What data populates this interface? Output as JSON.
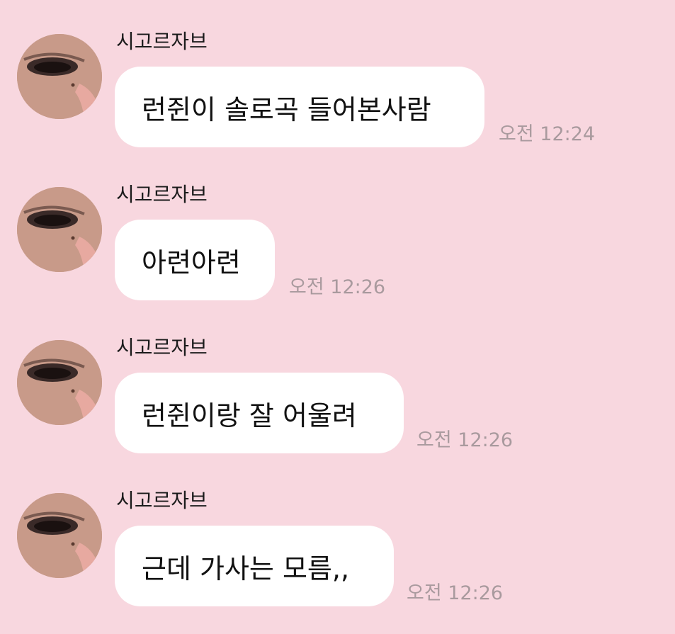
{
  "messages": [
    {
      "sender": "시고르자브",
      "text": "런쥔이 솔로곡 들어본사람",
      "time": "오전 12:24"
    },
    {
      "sender": "시고르자브",
      "text": "아련아련",
      "time": "오전 12:26"
    },
    {
      "sender": "시고르자브",
      "text": "런쥔이랑 잘 어울려",
      "time": "오전 12:26"
    },
    {
      "sender": "시고르자브",
      "text": "근데 가사는 모름,,",
      "time": "오전 12:26"
    }
  ]
}
